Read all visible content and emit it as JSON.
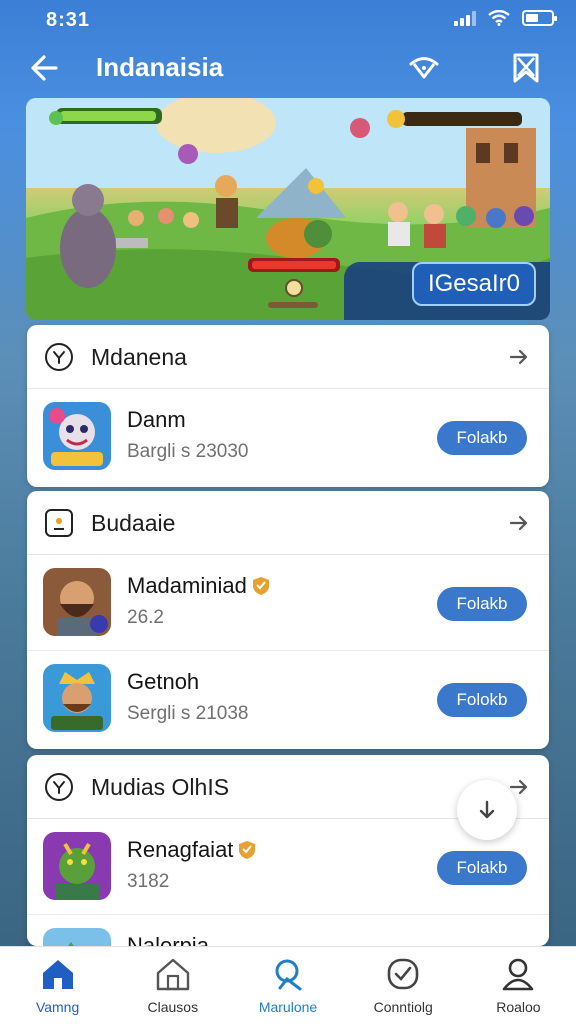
{
  "status_bar": {
    "time": "8:31",
    "battery_level": 0.5
  },
  "app_bar": {
    "title": "Indanaisia"
  },
  "banner": {
    "cta_label": "IGesaIr0"
  },
  "sections": [
    {
      "title": "Mdanena",
      "icon": "location-pin-icon",
      "items": [
        {
          "name": "Danm",
          "sub": "Bargli s 23030",
          "button": "Folakb",
          "thumb": "clown-hero-art",
          "verified": false
        }
      ]
    },
    {
      "title": "Budaaie",
      "icon": "id-card-icon",
      "items": [
        {
          "name": "Madaminiad",
          "sub": "26.2",
          "button": "Folakb",
          "thumb": "bearded-warrior-art",
          "verified": true
        },
        {
          "name": "Getnoh",
          "sub": "Sergli s 21038",
          "button": "Folokb",
          "thumb": "crowned-king-art",
          "verified": false
        }
      ]
    },
    {
      "title": "Mudias OlhIS",
      "icon": "location-pin-icon",
      "items": [
        {
          "name": "Renagfaiat",
          "sub": "3182",
          "button": "Folakb",
          "thumb": "green-goblin-art",
          "verified": true
        },
        {
          "name": "Nalerpia",
          "sub": "",
          "button": "",
          "thumb": "mountain-landscape-art",
          "verified": false
        }
      ]
    }
  ],
  "bottom_nav": [
    {
      "label": "Vamng",
      "icon": "home-icon",
      "active": true
    },
    {
      "label": "Clausos",
      "icon": "house-outline-icon",
      "active": false
    },
    {
      "label": "Marulone",
      "icon": "search-icon",
      "active": false
    },
    {
      "label": "Conntiolg",
      "icon": "shield-check-icon",
      "active": false
    },
    {
      "label": "Roaloo",
      "icon": "profile-icon",
      "active": false
    }
  ],
  "colors": {
    "accent": "#3a78cc",
    "app_bar": "#3b7fd6",
    "nav_active": "#1f5fc4"
  }
}
